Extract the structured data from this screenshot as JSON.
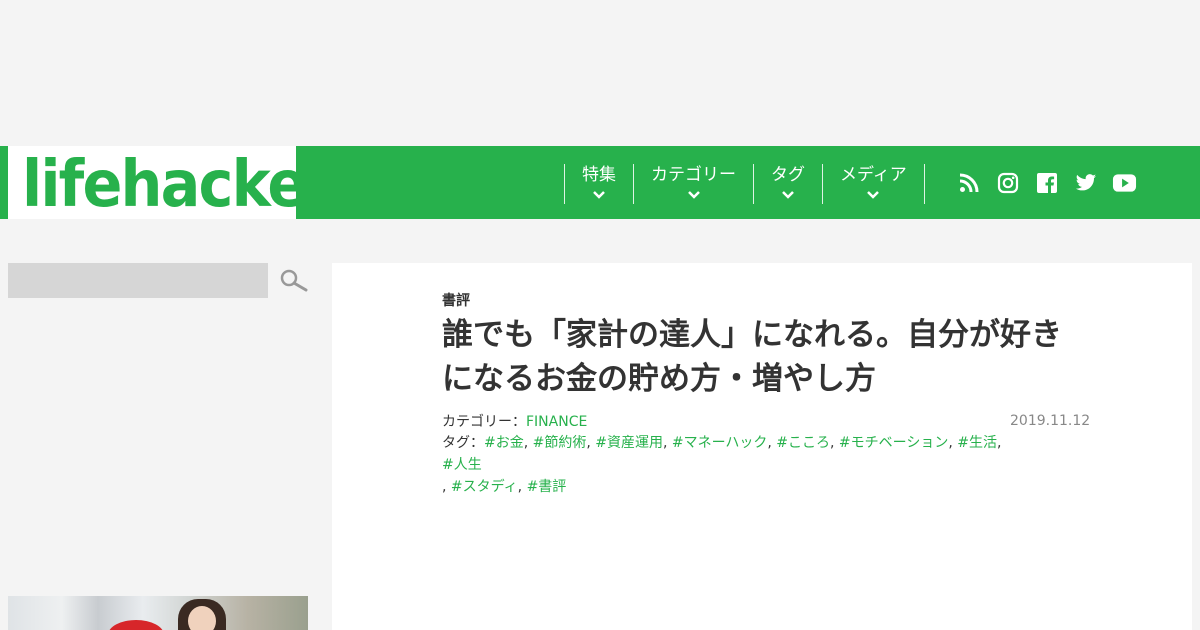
{
  "header": {
    "logo_text": "lifehacker",
    "nav": [
      {
        "label": "特集"
      },
      {
        "label": "カテゴリー"
      },
      {
        "label": "タグ"
      },
      {
        "label": "メディア"
      }
    ],
    "social_icons": [
      "rss-icon",
      "instagram-icon",
      "facebook-icon",
      "twitter-icon",
      "youtube-icon"
    ]
  },
  "sidebar": {
    "search": {
      "value": "",
      "placeholder": ""
    }
  },
  "article": {
    "section_label": "書評",
    "title": "誰でも「家計の達人」になれる。自分が好きになるお金の貯め方・増やし方",
    "category_prefix": "カテゴリー：",
    "category": "FINANCE",
    "date": "2019.11.12",
    "tags_prefix": "タグ：",
    "tags": [
      "#お金",
      "#節約術",
      "#資産運用",
      "#マネーハック",
      "#こころ",
      "#モチベーション",
      "#生活",
      "#人生",
      "#スタディ",
      "#書評"
    ]
  },
  "colors": {
    "brand_green": "#27b14c",
    "background": "#f4f4f4",
    "card": "#ffffff"
  }
}
